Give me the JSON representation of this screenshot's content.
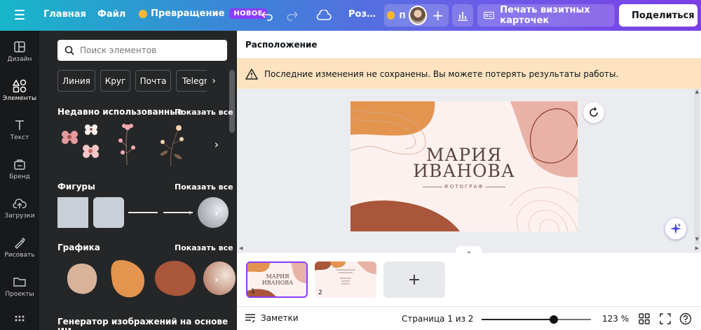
{
  "topbar": {
    "home": "Главная",
    "file": "Файл",
    "transform": "Превращение",
    "transform_badge": "НОВОЕ",
    "doc_title": "Роз…",
    "crown_chip_label": "П",
    "print_button": "Печать визитных карточек",
    "share_button": "Поделиться"
  },
  "rail": {
    "items": [
      {
        "label": "Дизайн",
        "icon": "layout-icon"
      },
      {
        "label": "Элементы",
        "icon": "elements-icon"
      },
      {
        "label": "Текст",
        "icon": "text-icon"
      },
      {
        "label": "Бренд",
        "icon": "brand-icon"
      },
      {
        "label": "Загрузки",
        "icon": "upload-icon"
      },
      {
        "label": "Рисовать",
        "icon": "draw-icon"
      },
      {
        "label": "Проекты",
        "icon": "folder-icon"
      }
    ]
  },
  "panel": {
    "search_placeholder": "Поиск элементов",
    "pills": [
      "Линия",
      "Круг",
      "Почта",
      "Telegram"
    ],
    "sections": {
      "recent": "Недавно использованные",
      "shapes": "Фигуры",
      "graphics": "Графика",
      "ai_generator": "Генератор изображений на основе ИИ"
    },
    "see_all": "Показать все"
  },
  "canvas": {
    "section_label": "Расположение",
    "warning": "Последние изменения не сохранены. Вы можете потерять результаты работы.",
    "card": {
      "name_line1": "МАРИЯ",
      "name_line2": "ИВАНОВА",
      "subtitle": "ФОТОГРАФ"
    }
  },
  "pages": {
    "page1_num": "1",
    "page2_num": "2",
    "thumb1_line1": "МАРИЯ",
    "thumb1_line2": "ИВАНОВА",
    "add": "+"
  },
  "bottom": {
    "notes": "Заметки",
    "page_indicator": "Страница 1 из 2",
    "zoom": "123 %",
    "zoom_fraction": 0.66
  },
  "colors": {
    "accent": "#8b3dff",
    "warning_bg": "#fde3c0",
    "panel_bg": "#252627",
    "rail_bg": "#18191b",
    "card_orange": "#e3944e",
    "card_brown": "#a9563a",
    "card_pink": "#e8b3a6"
  }
}
